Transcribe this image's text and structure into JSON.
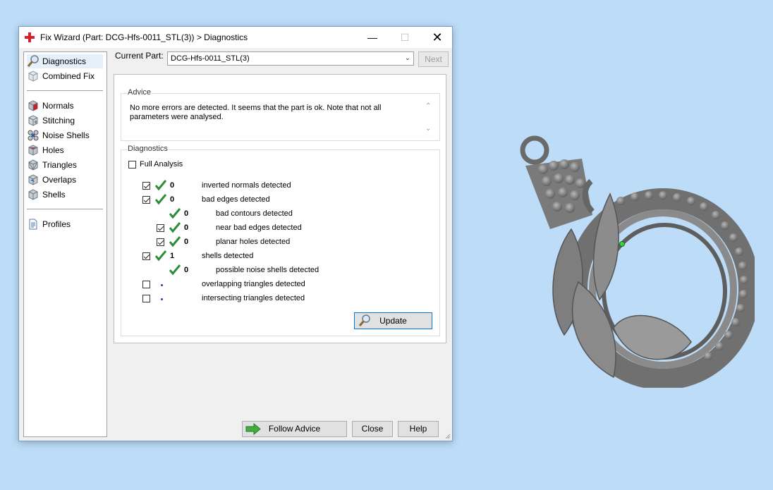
{
  "window": {
    "title": "Fix Wizard (Part: DCG-Hfs-0011_STL(3)) > Diagnostics",
    "buttons": {
      "minimize": "—",
      "maximize": "☐",
      "close": "✕"
    }
  },
  "sidebar": {
    "items": [
      {
        "label": "Diagnostics",
        "icon": "magnifier-icon",
        "selected": true
      },
      {
        "label": "Combined Fix",
        "icon": "cube-icon"
      },
      {
        "label": "Normals",
        "icon": "normals-cube-icon"
      },
      {
        "label": "Stitching",
        "icon": "stitching-cube-icon"
      },
      {
        "label": "Noise Shells",
        "icon": "noise-shells-icon"
      },
      {
        "label": "Holes",
        "icon": "holes-cube-icon"
      },
      {
        "label": "Triangles",
        "icon": "triangles-cube-icon"
      },
      {
        "label": "Overlaps",
        "icon": "overlaps-cube-icon"
      },
      {
        "label": "Shells",
        "icon": "shells-cube-icon"
      },
      {
        "label": "Profiles",
        "icon": "document-icon"
      }
    ]
  },
  "current_part": {
    "label": "Current Part:",
    "value": "DCG-Hfs-0011_STL(3)",
    "next_label": "Next"
  },
  "advice": {
    "heading": "Advice",
    "text": "No more errors are detected. It seems that the part is ok. Note that not all parameters were analysed."
  },
  "diagnostics": {
    "heading": "Diagnostics",
    "full_analysis_label": "Full Analysis",
    "rows": [
      {
        "checked": true,
        "status": "ok",
        "count": "0",
        "label": "inverted normals detected"
      },
      {
        "checked": true,
        "status": "ok",
        "count": "0",
        "label": "bad edges detected"
      },
      {
        "checked": null,
        "status": "ok",
        "count": "0",
        "label": "bad contours detected"
      },
      {
        "checked": true,
        "status": "ok",
        "count": "0",
        "label": "near bad edges detected"
      },
      {
        "checked": true,
        "status": "ok",
        "count": "0",
        "label": "planar holes detected"
      },
      {
        "checked": true,
        "status": "ok",
        "count": "1",
        "label": "shells detected"
      },
      {
        "checked": null,
        "status": "ok",
        "count": "0",
        "label": "possible noise shells detected"
      },
      {
        "checked": false,
        "status": "pending",
        "count": "",
        "label": "overlapping triangles detected"
      },
      {
        "checked": false,
        "status": "pending",
        "count": "",
        "label": "intersecting triangles detected"
      }
    ],
    "update_label": "Update"
  },
  "footer": {
    "follow_advice_label": "Follow Advice",
    "close_label": "Close",
    "help_label": "Help"
  },
  "colors": {
    "desktop": "#bcdcf8",
    "tick_green": "#2e8b3a",
    "focus_blue": "#0078d7"
  }
}
